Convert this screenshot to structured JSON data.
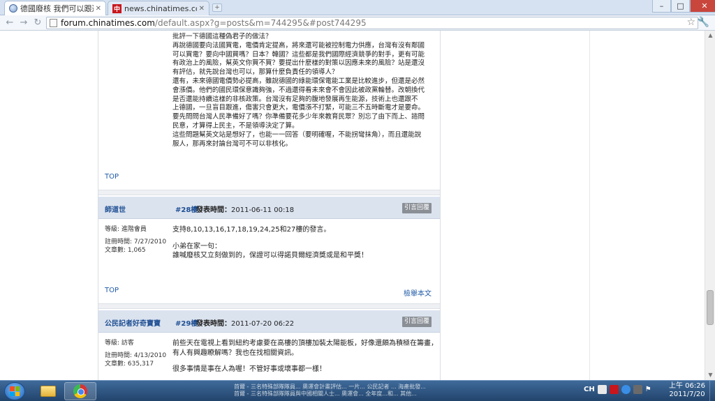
{
  "browser": {
    "tabs": [
      {
        "title": "德國廢核 我們可以跟進嗎",
        "icon": "globe-icon",
        "active": true
      },
      {
        "title": "news.chinatimes.com/fo",
        "icon": "chinatimes-icon",
        "active": false
      }
    ],
    "new_tab": "+",
    "window_controls": {
      "minimize": "–",
      "maximize": "□",
      "close": "✕"
    },
    "nav": {
      "back": "←",
      "forward": "→",
      "reload": "↻"
    },
    "url_host": "forum.chinatimes.com",
    "url_path": "/default.aspx?g=posts&m=744295&#post744295",
    "bookmark": "☆",
    "menu": "🔧"
  },
  "posts": [
    {
      "id": "prev",
      "body": [
        "批評一下德國這種偽君子的做法？",
        "再說德國要向法國買電，電價肯定提高，將來還可能被控制電力供應，台灣有沒有鄰國",
        "可以買電？要向中國買嗎？日本？韓國？這些都是我們國際經濟競爭的對手，更有可能",
        "有政治上的風險，幫英文你買不買？要提出什麼樣的對策以因應未來的風險？站是還沒",
        "有評估，就先說台灣也可以，那算什麼負責任的領導人？",
        "還有，未來德國電價勢必提高，雖說德國的綠能環保電能工業是比較進步，但還是必然",
        "會漲價。他們的國民環保意識夠強，不過還得看未來會不會因此被政黨輪替。改朝換代",
        "是否還能持續這樣的非核政策。台灣沒有足夠的腹地發展再生能源，技術上也還跟不",
        "上德國，一旦盲目跟進，傷害只會更大，電價漲不打緊，可能三不五時斷電才是要命。",
        "要先問問台灣人民準備好了嗎？你準備要花多少年來教育民眾？別忘了由下而上、諮問",
        "民意，才算得上民主，不是領導決定了算。",
        "這些問題幫英文站是想好了，也能一一回答（要明確喔，不能拐彎抹角），而且還能說",
        "服人，那再來討論台灣可不可以非核化。"
      ],
      "top": "TOP"
    },
    {
      "id": "28",
      "author": "師道世",
      "floor": "#28樓",
      "time_label": "發表時間：",
      "time": "2011-06-11 00:18",
      "reply": "引言回覆",
      "meta": [
        "等級: 進階會員",
        "",
        "註冊時間: 7/27/2010",
        "文章數: 1,065"
      ],
      "body": [
        "支持8,10,13,16,17,18,19,24,25和27樓的發言。",
        "",
        "小弟在家一句：",
        "誰喊廢核又立刻做到的，保證可以得諾貝爾經濟獎或是和平獎！"
      ],
      "top": "TOP",
      "report": "檢舉本文"
    },
    {
      "id": "29",
      "author": "公民記者好奇寶寶",
      "floor": "#29樓",
      "time_label": "發表時間：",
      "time": "2011-07-20 06:22",
      "reply": "引言回覆",
      "meta": [
        "等級: 訪客",
        "",
        "註冊時間: 4/13/2010",
        "文章數: 635,317"
      ],
      "body": [
        "前些天在電視上看到紐約考慮要在高樓的頂樓加裝太陽能板，好像還頗為積極在籌畫，",
        "有人有興趣瞭解嗎？我也在找相關資訊。",
        "",
        "很多事情是事在人為喔！不管好事或壞事都一樣！"
      ]
    }
  ],
  "taskbar": {
    "ticker": [
      "首爾 - 三名特殊部隊隊員... 奧運會計畫評估... 一片... 公民記者 ... 海產批發...",
      "首爾 - 三名特殊部隊隊員與中國相關人士... 奧運會... 全年度...和... 其他..."
    ],
    "ime": "CH",
    "clock_time": "上午 06:26",
    "clock_date": "2011/7/20"
  },
  "colors": {
    "accent": "#1f4f93",
    "link": "#1f5aa6",
    "header_bg": "#dbe3ef"
  }
}
